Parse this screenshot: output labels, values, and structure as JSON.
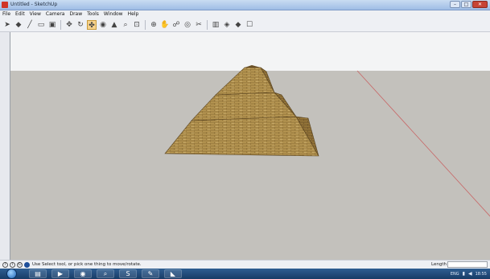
{
  "window": {
    "title": "Untitled - SketchUp",
    "minimize": "–",
    "maximize": "□",
    "close": "✕"
  },
  "menu": [
    "File",
    "Edit",
    "View",
    "Camera",
    "Draw",
    "Tools",
    "Window",
    "Help"
  ],
  "toolbar": {
    "tools": [
      {
        "name": "select-tool-icon",
        "glyph": "➤",
        "selected": false
      },
      {
        "name": "eraser-tool-icon",
        "glyph": "◆",
        "selected": false
      },
      {
        "name": "line-tool-icon",
        "glyph": "╱",
        "selected": false
      },
      {
        "name": "shape-tool-icon",
        "glyph": "▭",
        "selected": false
      },
      {
        "name": "pushpull-tool-icon",
        "glyph": "▣",
        "selected": false
      },
      {
        "name": "move-tool-icon",
        "glyph": "✥",
        "selected": false
      },
      {
        "name": "rotate-tool-icon",
        "glyph": "↻",
        "selected": false
      },
      {
        "name": "orbit-tool-icon",
        "glyph": "✤",
        "selected": true
      },
      {
        "name": "tape-tool-icon",
        "glyph": "◉",
        "selected": false
      },
      {
        "name": "paint-tool-icon",
        "glyph": "▲",
        "selected": false
      },
      {
        "name": "zoom-tool-icon",
        "glyph": "⌕",
        "selected": false
      },
      {
        "name": "zoom-window-icon",
        "glyph": "⊡",
        "selected": false
      },
      {
        "name": "zoom-extents-icon",
        "glyph": "⊕",
        "selected": false
      },
      {
        "name": "pan-tool-icon",
        "glyph": "✋",
        "selected": false
      },
      {
        "name": "walk-tool-icon",
        "glyph": "☍",
        "selected": false
      },
      {
        "name": "look-around-icon",
        "glyph": "◎",
        "selected": false
      },
      {
        "name": "section-tool-icon",
        "glyph": "✂",
        "selected": false
      },
      {
        "name": "components-icon",
        "glyph": "▥",
        "selected": false
      },
      {
        "name": "warehouse-icon",
        "glyph": "◈",
        "selected": false
      },
      {
        "name": "extension-icon",
        "glyph": "◆",
        "selected": false
      },
      {
        "name": "model-info-icon",
        "glyph": "☐",
        "selected": false
      }
    ]
  },
  "status": {
    "hint": "Use Select tool, or pick one thing to move/rotate.",
    "measure_label": "Length",
    "measure_value": ""
  },
  "taskbar": {
    "apps": [
      {
        "name": "explorer-icon",
        "glyph": "▤"
      },
      {
        "name": "media-player-icon",
        "glyph": "▶"
      },
      {
        "name": "chrome-icon",
        "glyph": "◉"
      },
      {
        "name": "search-app-icon",
        "glyph": "⌕"
      },
      {
        "name": "skype-icon",
        "glyph": "S"
      },
      {
        "name": "notepad-icon",
        "glyph": "✎"
      },
      {
        "name": "sketchup-taskbar-icon",
        "glyph": "◣"
      }
    ],
    "clock": "18:55",
    "lang": "ENG"
  },
  "colors": {
    "sky": "#f3f4f5",
    "ground": "#c3c1bc",
    "axis_red": "#c86565",
    "stone_light": "#c2a25c",
    "stone_dark": "#8a6d35",
    "stone_shadow": "#6a5027"
  }
}
